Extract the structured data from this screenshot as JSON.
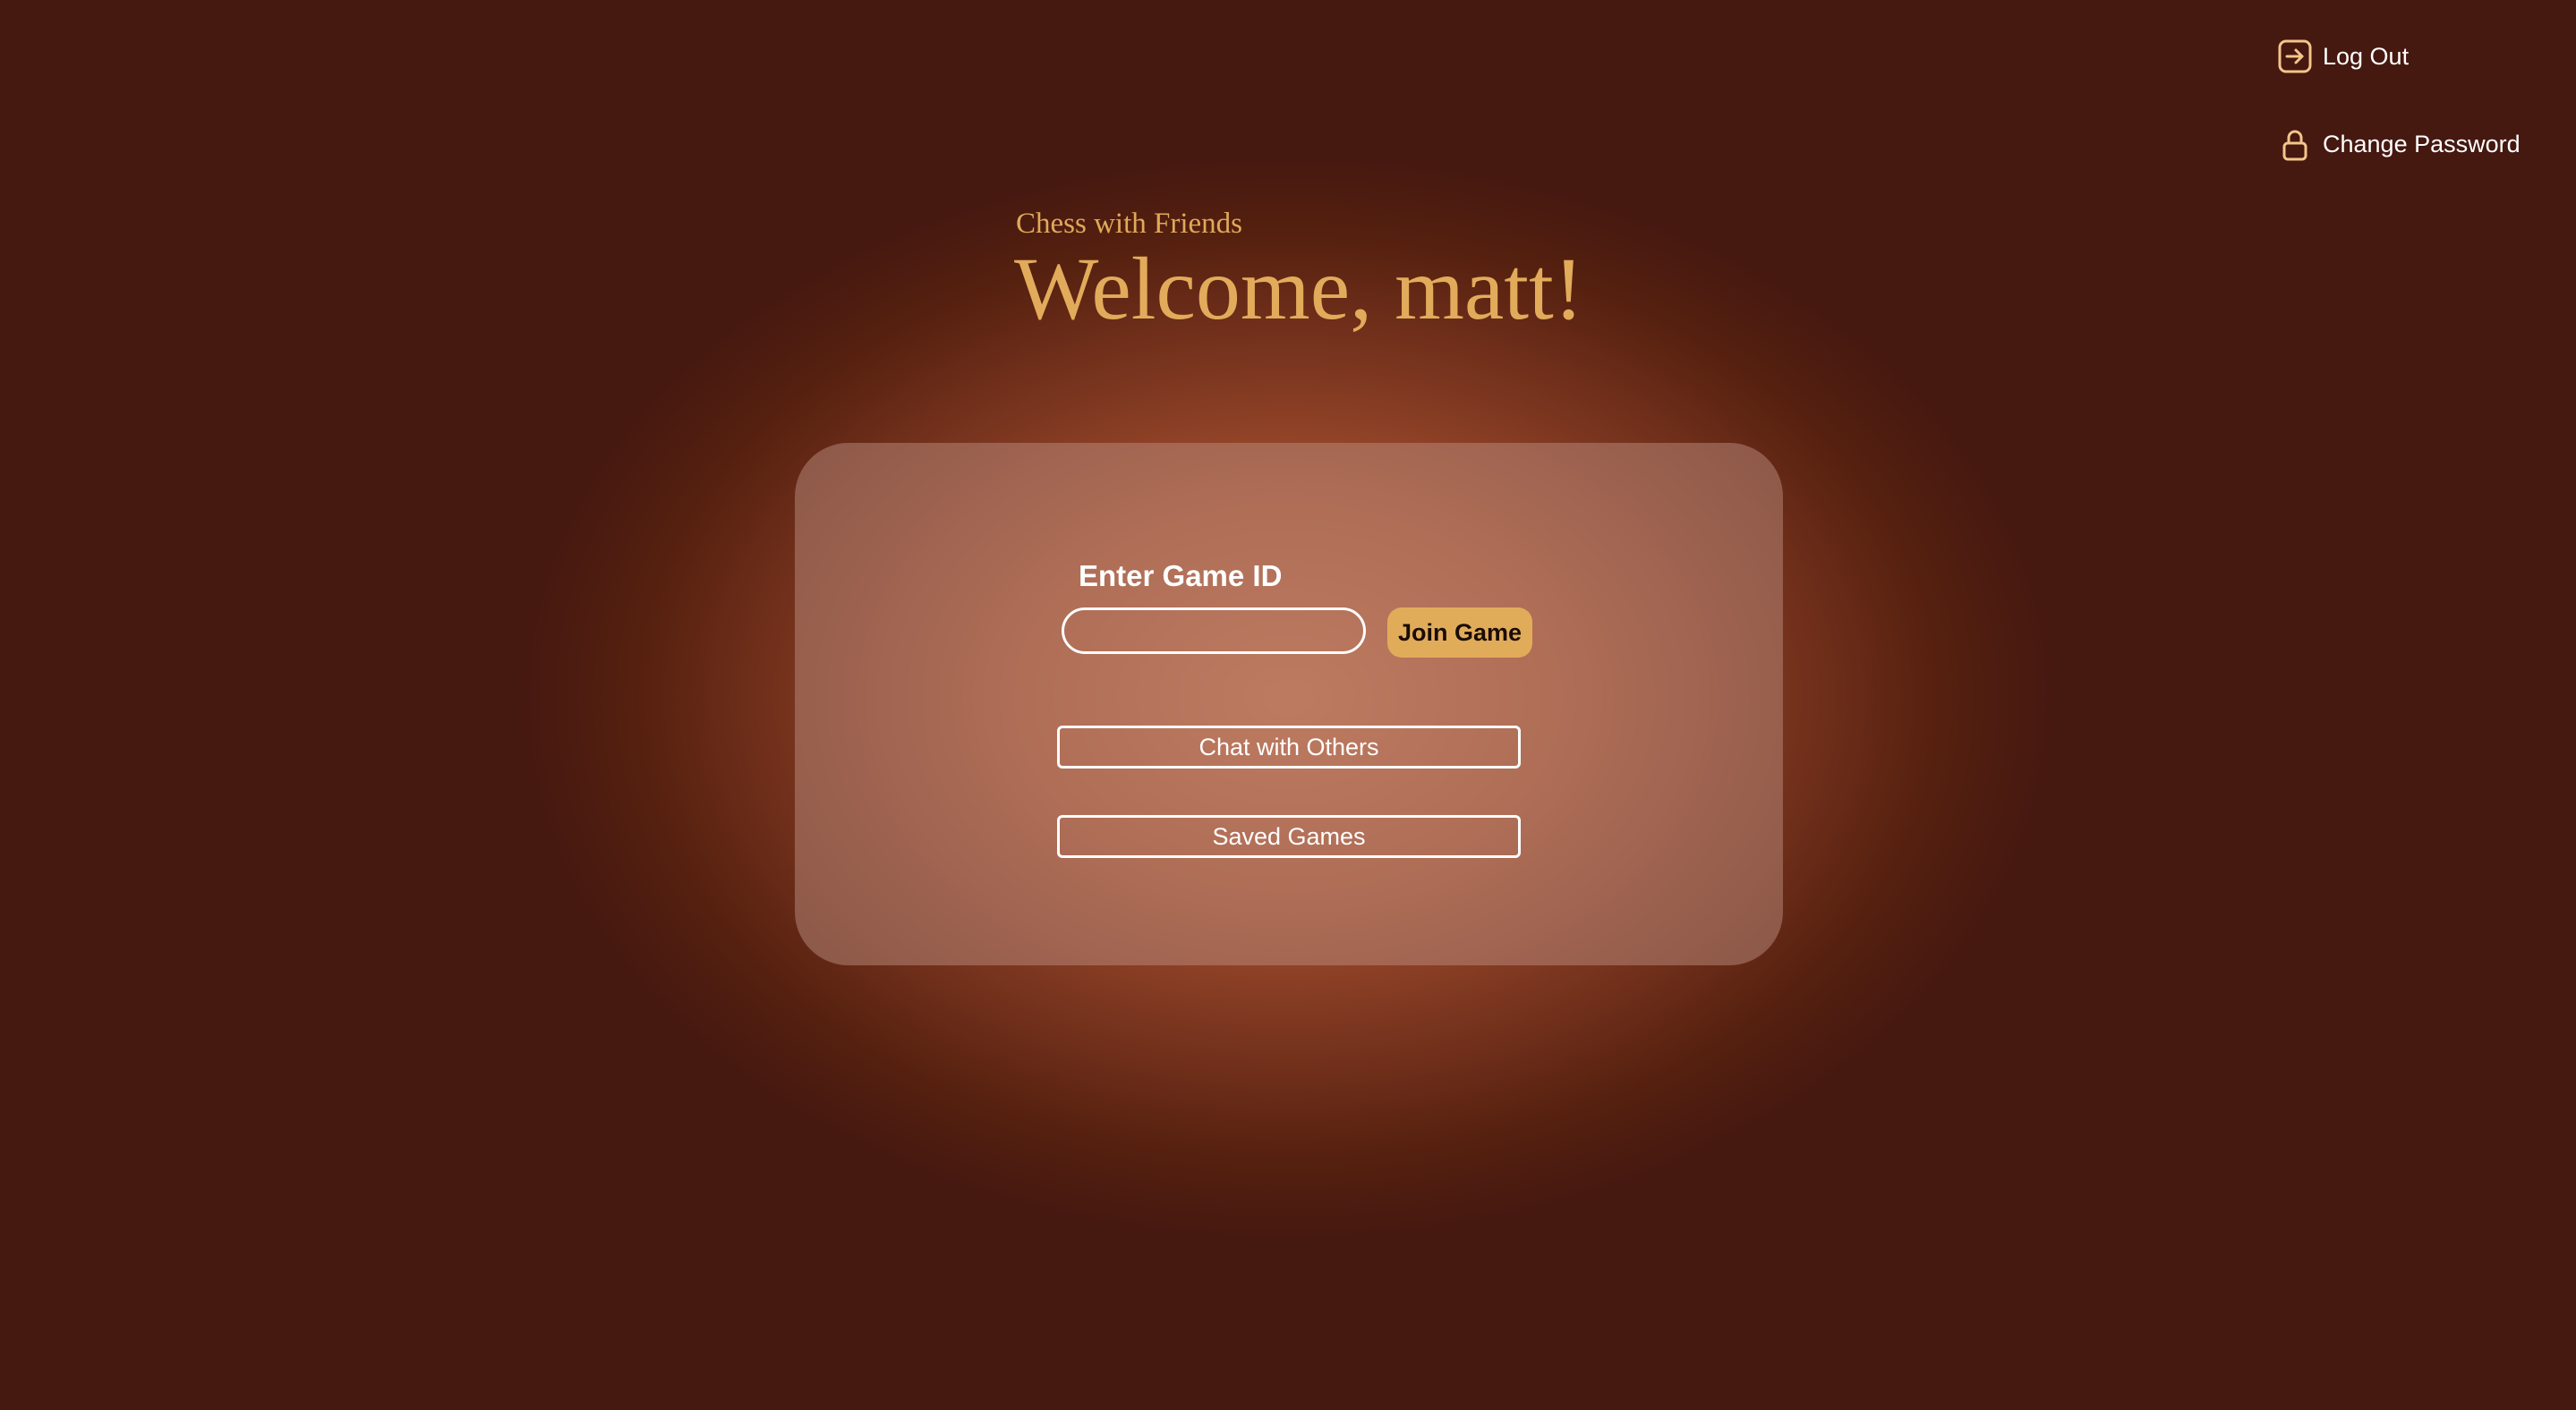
{
  "nav": {
    "logout": {
      "label": "Log Out",
      "icon": "logout-icon"
    },
    "change_password": {
      "label": "Change Password",
      "icon": "lock-icon"
    }
  },
  "header": {
    "subtitle": "Chess with Friends",
    "welcome": "Welcome, matt!"
  },
  "join": {
    "label": "Enter Game ID",
    "input_value": "",
    "input_placeholder": "",
    "button_label": "Join Game"
  },
  "actions": {
    "chat_label": "Chat with Others",
    "saved_label": "Saved Games"
  },
  "colors": {
    "background": "#451810",
    "accent": "#e1ac5a",
    "icon": "#f3c58a",
    "text": "#ffffff"
  }
}
